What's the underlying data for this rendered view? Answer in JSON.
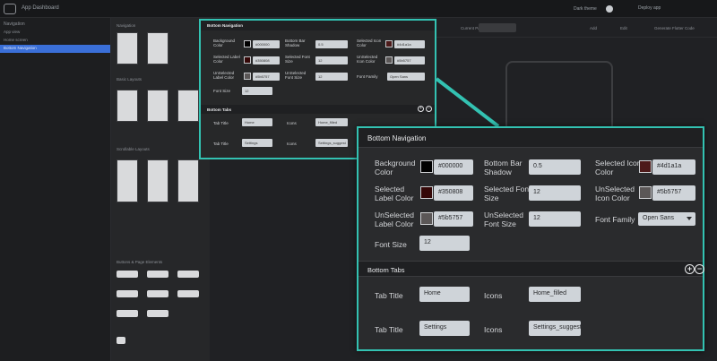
{
  "app": {
    "title": "App Dashboard",
    "top_right_label": "Dark theme",
    "top_right_button": "Deploy app"
  },
  "left_panel": {
    "header": "Navigation",
    "items": [
      {
        "label": "App view",
        "active": false
      },
      {
        "label": "Home screen",
        "active": false
      },
      {
        "label": "Bottom Navigation",
        "active": true
      }
    ]
  },
  "palette": {
    "sections": [
      "Navigation",
      "Basic Layouts",
      "Scrollable Layouts",
      "Buttons & Page Elements"
    ]
  },
  "canvas_toolbar": {
    "screen_label": "Current Page",
    "button1": "Add",
    "button2": "Edit",
    "button3": "Generate Flutter Code"
  },
  "small_panel": {
    "title": "Bottom Navigation",
    "fields": [
      {
        "label": "Background Color",
        "value": "#000000",
        "swatch": "#000000"
      },
      {
        "label": "Bottom Bar Shadow",
        "value": "0.5"
      },
      {
        "label": "Selected Icon Color",
        "value": "#4d1a1a",
        "swatch": "#4d1a1a"
      },
      {
        "label": "Selected Label Color",
        "value": "#350808",
        "swatch": "#350808"
      },
      {
        "label": "Selected Font Size",
        "value": "12"
      },
      {
        "label": "UnSelected Icon Color",
        "value": "#5b5757",
        "swatch": "#5b5757"
      },
      {
        "label": "UnSelected Label Color",
        "value": "#5b5757",
        "swatch": "#5b5757"
      },
      {
        "label": "UnSelected Font Size",
        "value": "12"
      },
      {
        "label": "Font Family",
        "value": "Open Sans"
      },
      {
        "label": "Font Size",
        "value": "12"
      }
    ],
    "tabs_title": "Bottom Tabs",
    "tabs": [
      {
        "title_label": "Tab Title",
        "title_value": "Home",
        "icons_label": "Icons",
        "icons_value": "Home_filled"
      },
      {
        "title_label": "Tab Title",
        "title_value": "Settings",
        "icons_label": "Icons",
        "icons_value": "Settings_suggest"
      }
    ]
  },
  "big_panel": {
    "title": "Bottom Navigation",
    "fields": [
      {
        "label_1": "Background",
        "label_2": "Color",
        "value": "#000000",
        "swatch": "#000000"
      },
      {
        "label_1": "Bottom Bar",
        "label_2": "Shadow",
        "value": "0.5"
      },
      {
        "label_1": "Selected Icon",
        "label_2": "Color",
        "value": "#4d1a1a",
        "swatch": "#4d1a1a"
      },
      {
        "label_1": "Selected",
        "label_2": "Label Color",
        "value": "#350808",
        "swatch": "#350808"
      },
      {
        "label_1": "Selected Font",
        "label_2": "Size",
        "value": "12"
      },
      {
        "label_1": "UnSelected",
        "label_2": "Icon Color",
        "value": "#5b5757",
        "swatch": "#5b5757"
      },
      {
        "label_1": "UnSelected",
        "label_2": "Label Color",
        "value": "#5b5757",
        "swatch": "#5b5757"
      },
      {
        "label_1": "UnSelected",
        "label_2": "Font Size",
        "value": "12"
      },
      {
        "label_1": "Font Family",
        "label_2": "",
        "value": "Open Sans"
      },
      {
        "label_1": "Font Size",
        "label_2": "",
        "value": "12"
      }
    ],
    "tabs_title": "Bottom Tabs",
    "add_symbol": "+",
    "remove_symbol": "−",
    "tabs": [
      {
        "title_label": "Tab Title",
        "title_value": "Home",
        "icons_label": "Icons",
        "icons_value": "Home_filled"
      },
      {
        "title_label": "Tab Title",
        "title_value": "Settings",
        "icons_label": "Icons",
        "icons_value": "Settings_suggest"
      }
    ]
  },
  "colors": {
    "highlight": "#33c2b2",
    "active_item": "#3a6fd8"
  },
  "icons": [
    "app-logo-icon",
    "add-circle-icon",
    "remove-circle-icon",
    "chevron-down-icon"
  ]
}
